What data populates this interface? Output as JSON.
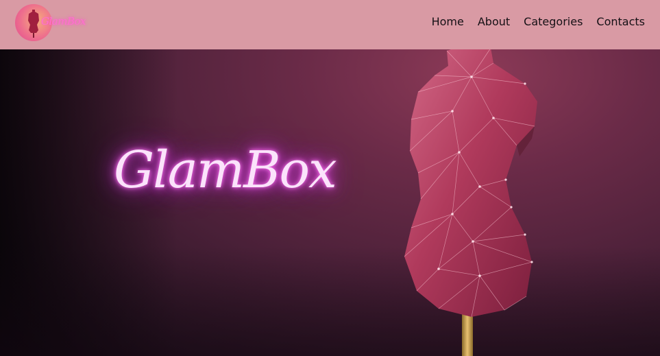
{
  "brand": {
    "logo_text": "GlamBox"
  },
  "nav": {
    "items": [
      {
        "label": "Home"
      },
      {
        "label": "About"
      },
      {
        "label": "Categories"
      },
      {
        "label": "Contacts"
      }
    ]
  },
  "hero": {
    "title": "GlamBox"
  },
  "colors": {
    "navbar_bg": "#d99aa4",
    "nav_text": "#151015",
    "neon_glow": "#e34fe0",
    "mannequin": "#b03a5c"
  }
}
